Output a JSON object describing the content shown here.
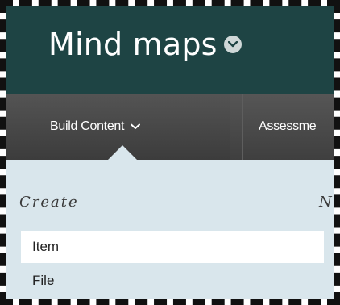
{
  "header": {
    "course_title": "Mind maps",
    "title_menu_icon": "chevron-down-circle-icon"
  },
  "toolbar": {
    "build_content_label": "Build Content",
    "build_content_icon": "chevron-down-icon",
    "assessments_label": "Assessme"
  },
  "menu": {
    "create_heading": "Create",
    "new_heading": "N",
    "items": [
      {
        "label": "Item",
        "highlighted": true
      },
      {
        "label": "File",
        "highlighted": false
      }
    ]
  },
  "colors": {
    "header_bg": "#1e4444",
    "toolbar_bg": "#4a4a4a",
    "menu_bg": "#d9e6ec",
    "highlight_bg": "#ffffff"
  }
}
